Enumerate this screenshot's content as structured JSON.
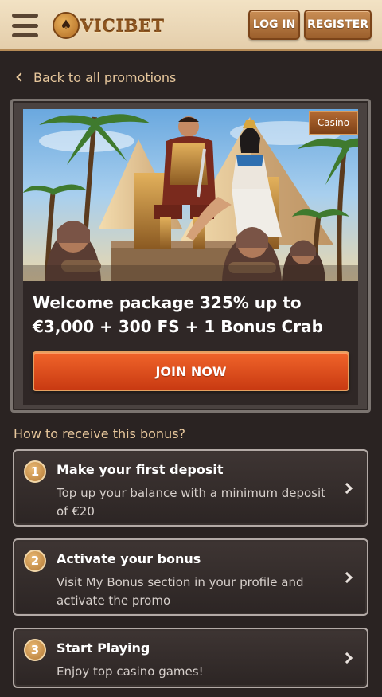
{
  "header": {
    "brand": "VICIBET",
    "login_label": "LOG IN",
    "register_label": "REGISTER"
  },
  "nav": {
    "back_label": "Back to all promotions"
  },
  "promo": {
    "category": "Casino",
    "title": "Welcome package 325% up to €3,000 + 300 FS + 1 Bonus Crab",
    "cta_label": "JOIN NOW"
  },
  "how": {
    "title": "How to receive this bonus?",
    "steps": [
      {
        "number": "1",
        "title": "Make your first deposit",
        "description": "Top up your balance with a minimum deposit of €20"
      },
      {
        "number": "2",
        "title": "Activate your bonus",
        "description": "Visit My Bonus section in your profile and activate the promo"
      },
      {
        "number": "3",
        "title": "Start Playing",
        "description": "Enjoy top casino games!"
      }
    ]
  },
  "colors": {
    "accent": "#e7c79c",
    "cta": "#e04e1d",
    "background": "#2a2322",
    "header": "#ecd7b4"
  }
}
